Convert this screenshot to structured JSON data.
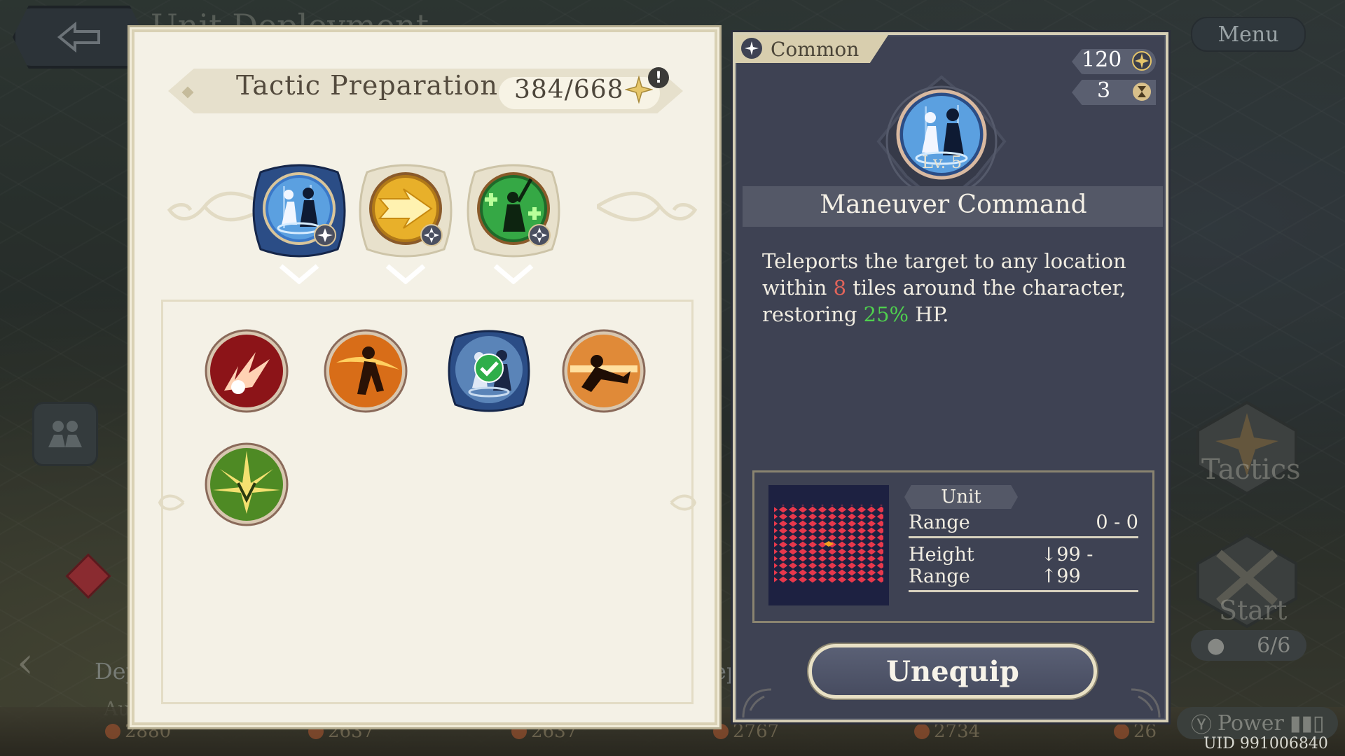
{
  "background": {
    "faded_title": "Unit Deployment",
    "menu_label": "Menu",
    "tactics_label": "Tactics",
    "start_label": "Start",
    "unit_count": "6/6",
    "power_label": "Power",
    "uid": "UID 991006840",
    "deploy_label": "Dep",
    "deploy_label_2": "ep",
    "auto_label": "Au",
    "bottom_values": [
      "2880",
      "2637",
      "2637",
      "2767",
      "2734",
      "26"
    ]
  },
  "left_panel": {
    "title": "Tactic Preparation",
    "points": "384/668",
    "equipped": [
      {
        "name": "maneuver-command",
        "icon": "teleport-figures-icon",
        "color": "#2d5fa8"
      },
      {
        "name": "lightning-arrow",
        "icon": "golden-arrow-icon",
        "color": "#d8a020"
      },
      {
        "name": "healing-strike",
        "icon": "green-warrior-icon",
        "color": "#2e9a3a"
      }
    ],
    "inventory": [
      {
        "name": "fire-burst",
        "icon": "red-flame-burst-icon",
        "color": "#b8262a"
      },
      {
        "name": "flame-dash",
        "icon": "orange-runner-icon",
        "color": "#e07a20"
      },
      {
        "name": "maneuver-command",
        "icon": "teleport-figures-icon",
        "color": "#2d5fa8",
        "equipped": true
      },
      {
        "name": "charge",
        "icon": "sliding-figure-icon",
        "color": "#c85a28"
      },
      {
        "name": "radiant-blessing",
        "icon": "golden-burst-icon",
        "color": "#8ab030"
      }
    ]
  },
  "right_panel": {
    "rarity": "Common",
    "cost": "120",
    "cooldown": "3",
    "level": "Lv. 5",
    "skill_name": "Maneuver Command",
    "desc_part1": "Teleports the target to any location within ",
    "desc_tiles": "8",
    "desc_part2": " tiles around the character, restoring ",
    "desc_percent": "25%",
    "desc_part3": " HP.",
    "target_type": "Unit",
    "range_label": "Range",
    "range_value": "0 - 0",
    "height_label": "Height Range",
    "height_value": "↓99 - ↑99",
    "unequip_label": "Unequip"
  }
}
